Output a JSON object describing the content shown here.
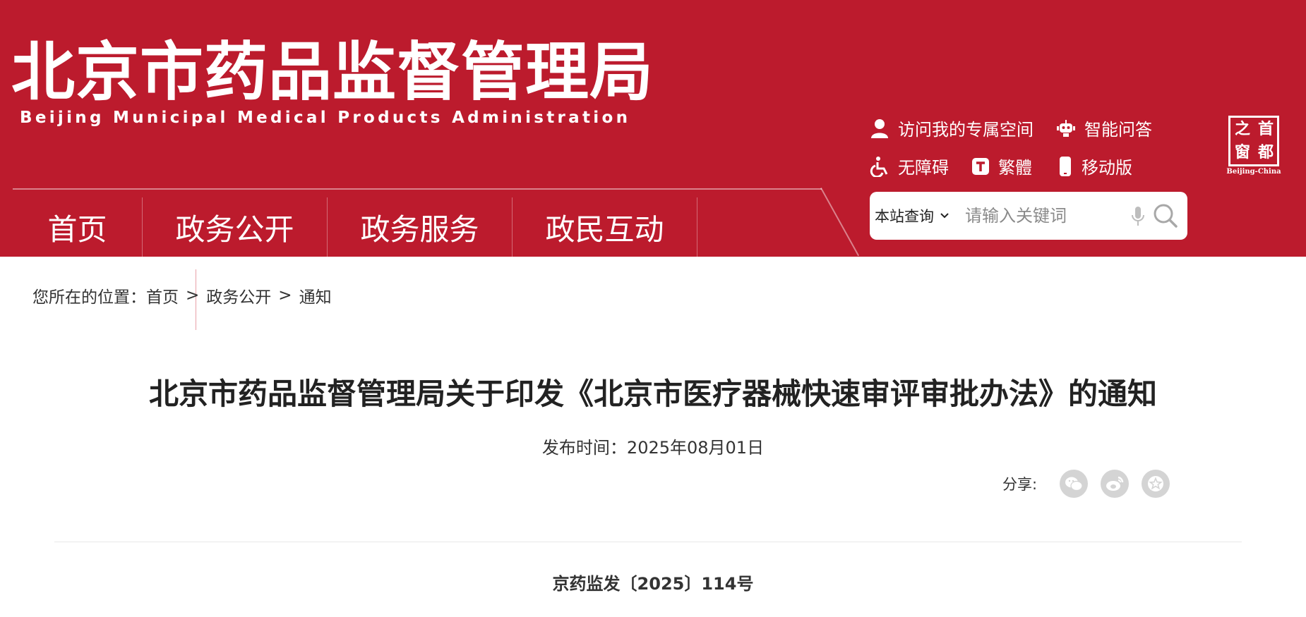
{
  "header": {
    "logo_cn": "北京市药品监督管理局",
    "logo_en": "Beijing Municipal Medical Products Administration",
    "toplinks": {
      "personal_space": "访问我的专属空间",
      "smart_qa": "智能问答",
      "accessibility": "无障碍",
      "traditional": "繁體",
      "mobile": "移动版"
    },
    "badge": {
      "chars": [
        "之",
        "首",
        "窗",
        "都"
      ],
      "caption": "Beijing-China"
    }
  },
  "nav": {
    "items": [
      "首页",
      "政务公开",
      "政务服务",
      "政民互动"
    ]
  },
  "search": {
    "scope": "本站查询",
    "placeholder": "请输入关键词"
  },
  "breadcrumb": {
    "prefix": "您所在的位置：",
    "home": "首页",
    "sep": ">",
    "section": "政务公开",
    "current": "通知"
  },
  "article": {
    "title": "北京市药品监督管理局关于印发《北京市医疗器械快速审评审批办法》的通知",
    "publish_label": "发布时间：",
    "publish_date": "2025年08月01日",
    "share_label": "分享:",
    "doc_number": "京药监发〔2025〕114号"
  },
  "icons": {
    "share": [
      "wechat-icon",
      "weibo-icon",
      "favorite-icon"
    ]
  },
  "colors": {
    "brand_red": "#bc1b2d",
    "share_gray": "#d4d4d4"
  }
}
